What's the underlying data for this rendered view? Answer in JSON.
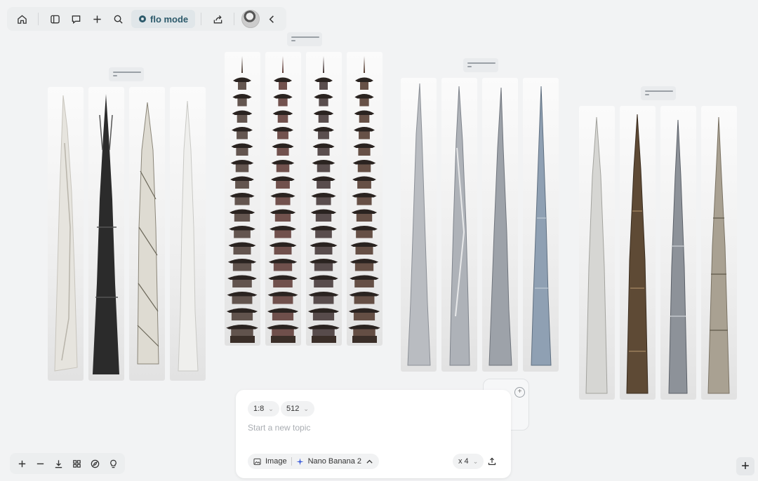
{
  "toolbar": {
    "mode_label": "flo mode",
    "icons": [
      "home-icon",
      "sidebar-icon",
      "comment-icon",
      "plus-icon",
      "search-icon",
      "share-icon",
      "avatar",
      "chevron-left-icon"
    ]
  },
  "composer": {
    "aspect_ratio": "1:8",
    "resolution": "512",
    "placeholder": "Start a new topic",
    "type_label": "Image",
    "model_label": "Nano Banana 2",
    "count_label": "x 4"
  },
  "bottom_toolbar": {
    "icons": [
      "zoom-in-icon",
      "zoom-out-icon",
      "download-icon",
      "grid-icon",
      "compass-icon",
      "lightbulb-icon"
    ]
  },
  "colors": {
    "background": "#f2f3f4",
    "accent": "#2c5a6b"
  },
  "groups": [
    {
      "style": "modern-white-black",
      "images": [
        "white-sculptural-tower",
        "black-gothic-spire",
        "white-twisted-lattice-tower",
        "white-organic-tower"
      ]
    },
    {
      "style": "pagoda",
      "images": [
        "dark-pagoda",
        "red-gold-pagoda",
        "dark-red-pagoda",
        "brown-red-pagoda"
      ]
    },
    {
      "style": "glass-skyscraper",
      "images": [
        "silver-supertall",
        "silver-twisted-supertall",
        "steel-supertall",
        "blue-glass-supertall"
      ]
    },
    {
      "style": "fantasy-spire",
      "images": [
        "white-tendril-spire",
        "bronze-ornate-spire",
        "steel-futuristic-spire",
        "stone-gothic-tower"
      ]
    }
  ]
}
